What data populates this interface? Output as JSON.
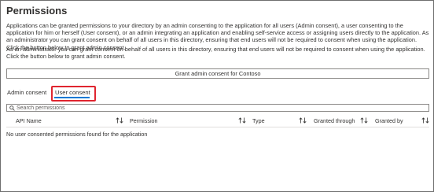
{
  "page": {
    "title": "Permissions",
    "description_1": "Applications can be granted permissions to your directory by an admin consenting to the application for all users (Admin consent), a user consenting to the application for him or herself (User consent), or an admin integrating an application and enabling self-service access or assigning users directly to the application. As an administrator you can grant consent on behalf of all users in this directory, ensuring that end users will not be required to consent when using the application. Click the button below to grant admin consent.",
    "description_2": "As an administrator you can grant consent on behalf of all users in this directory, ensuring that end users will not be required to consent when using the application. Click the button below to grant admin consent.",
    "grant_button_label": "Grant admin consent for Contoso"
  },
  "tabs": [
    {
      "label": "Admin consent",
      "selected": false
    },
    {
      "label": "User consent",
      "selected": true
    }
  ],
  "search": {
    "placeholder": "Search permissions",
    "value": ""
  },
  "table": {
    "columns": [
      "API Name",
      "Permission",
      "Type",
      "Granted through",
      "Granted by"
    ],
    "empty_message": "No user consented permissions found for the application"
  },
  "colors": {
    "accent": "#0078d4",
    "highlight_box": "#e0252f",
    "text": "#323130",
    "border": "#8a8886"
  },
  "icons": {
    "search": "search-icon",
    "sort": "sort-arrows-icon"
  }
}
